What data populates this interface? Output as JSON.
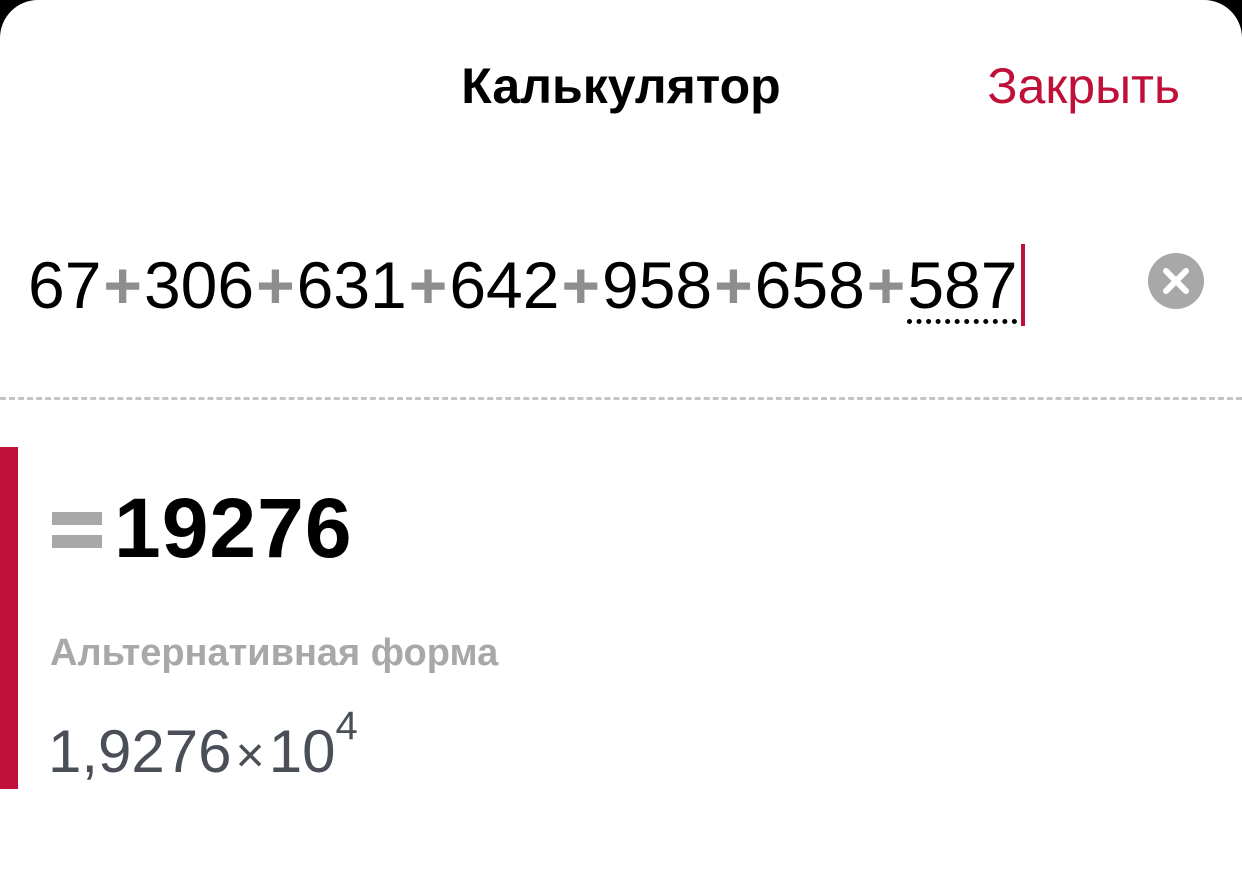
{
  "header": {
    "title": "Калькулятор",
    "close_label": "Закрыть"
  },
  "expression": {
    "terms": [
      "67",
      "306",
      "631",
      "642",
      "958",
      "658",
      "587"
    ],
    "operator": "+"
  },
  "icons": {
    "clear": "clear-circle-x-icon",
    "equals": "equals-icon"
  },
  "result": {
    "value": "19276",
    "alt_label": "Альтернативная форма",
    "alt_mantissa": "1,9276",
    "alt_times": "×",
    "alt_base": "10",
    "alt_exponent": "4"
  },
  "colors": {
    "accent": "#c0103a",
    "operator": "#8e8e8e",
    "muted": "#a8a8a8",
    "alt_text": "#4a4e57"
  }
}
